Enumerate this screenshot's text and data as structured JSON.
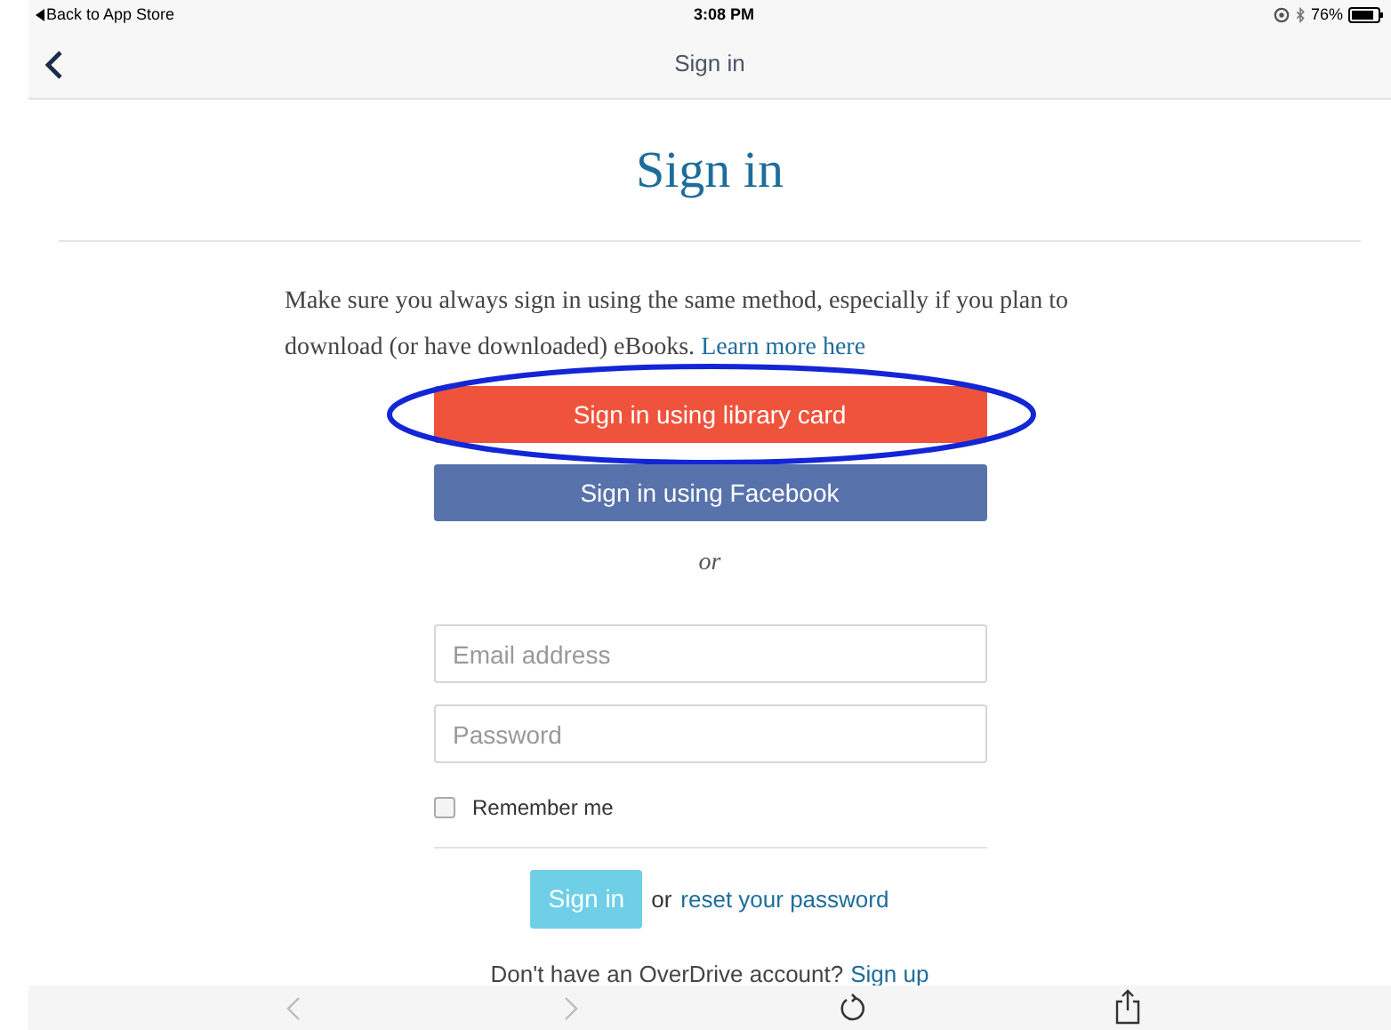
{
  "status_bar": {
    "back_label": "Back to App Store",
    "time": "3:08 PM",
    "battery": "76%"
  },
  "nav_bar": {
    "title": "Sign in"
  },
  "page": {
    "heading": "Sign in",
    "intro": "Make sure you always sign in using the same method, especially if you plan to download (or have downloaded) eBooks.",
    "intro_link": "Learn more here",
    "buttons": [
      {
        "kind": "library",
        "label": "Sign in using library card",
        "highlighted": true
      },
      {
        "kind": "facebook",
        "label": "Sign in using Facebook",
        "highlighted": false
      }
    ],
    "or_text": "or",
    "email": {
      "placeholder": "Email address"
    },
    "password": {
      "placeholder": "Password"
    },
    "remember": {
      "label": "Remember me",
      "checked": false
    },
    "submit": "Sign in",
    "reset_prefix": "or",
    "reset_link": "reset your password",
    "signup_text": "Don't have an OverDrive account?",
    "signup_link": "Sign up"
  }
}
